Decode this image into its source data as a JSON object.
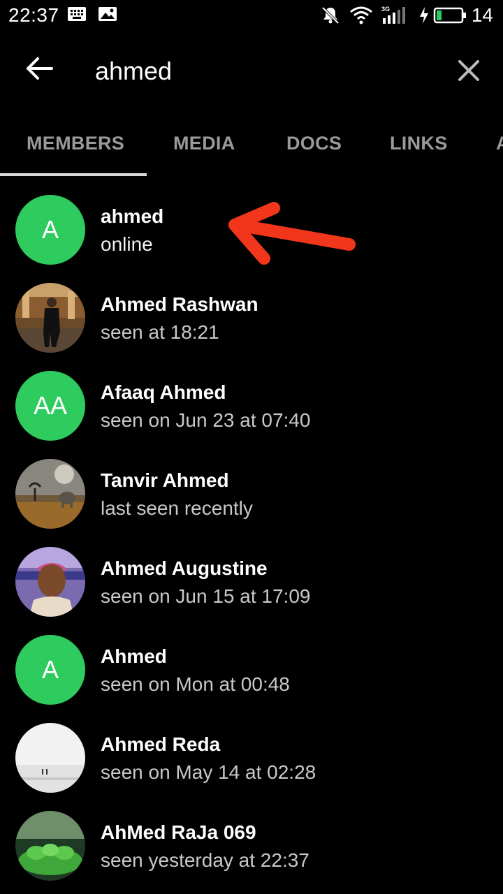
{
  "status_bar": {
    "time": "22:37",
    "battery_level": "14",
    "icons": [
      "keyboard-icon",
      "image-icon",
      "mute-icon",
      "wifi-icon",
      "3g-signal-icon",
      "charging-icon",
      "battery-icon"
    ]
  },
  "search": {
    "query": "ahmed"
  },
  "tabs": [
    {
      "label": "MEMBERS",
      "active": true
    },
    {
      "label": "MEDIA",
      "active": false
    },
    {
      "label": "DOCS",
      "active": false
    },
    {
      "label": "LINKS",
      "active": false
    },
    {
      "label": "A",
      "active": false
    }
  ],
  "members": [
    {
      "name": "ahmed",
      "status": "online",
      "avatar": "A",
      "avatar_color": "#2ecc5e"
    },
    {
      "name": "Ahmed Rashwan",
      "status": "seen at 18:21",
      "avatar": "photo-man-standing"
    },
    {
      "name": "Afaaq Ahmed",
      "status": "seen on Jun 23 at 07:40",
      "avatar": "AA",
      "avatar_color": "#2ecc5e"
    },
    {
      "name": "Tanvir Ahmed",
      "status": "last seen recently",
      "avatar": "photo-elephant-landscape"
    },
    {
      "name": "Ahmed Augustine",
      "status": "seen on Jun 15 at 17:09",
      "avatar": "photo-man-portrait"
    },
    {
      "name": "Ahmed",
      "status": "seen on Mon at 00:48",
      "avatar": "A",
      "avatar_color": "#2ecc5e"
    },
    {
      "name": "Ahmed Reda",
      "status": "seen on May 14 at 02:28",
      "avatar": "photo-beach-figures"
    },
    {
      "name": "AhMed RaJa 069",
      "status": "seen yesterday at 22:37",
      "avatar": "photo-green-caterpillars"
    }
  ],
  "colors": {
    "background": "#000000",
    "accent_avatar": "#2ecc5e",
    "annotation_arrow": "#f2361c"
  }
}
